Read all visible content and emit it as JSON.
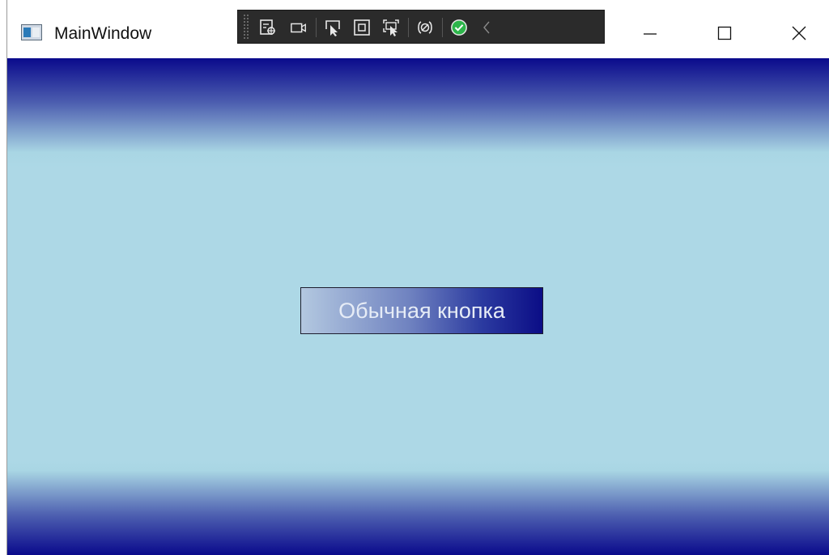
{
  "window": {
    "title": "MainWindow",
    "controls": {
      "minimize": "minimize-icon",
      "maximize": "maximize-icon",
      "close": "close-icon"
    }
  },
  "devtools": {
    "icons": [
      "live-visual-tree-icon",
      "record-icon",
      "select-element-icon",
      "display-layout-adorners-icon",
      "track-focus-icon",
      "binding-failures-icon",
      "hot-reload-status-icon",
      "collapse-icon"
    ]
  },
  "main": {
    "button_label": "Обычная кнопка"
  },
  "colors": {
    "background": "#ADD8E6",
    "gradient_edge": "#0A0A8C",
    "button_gradient_start": "#B3C8E0",
    "button_gradient_end": "#0B0D86",
    "status_ok": "#2db54b"
  }
}
